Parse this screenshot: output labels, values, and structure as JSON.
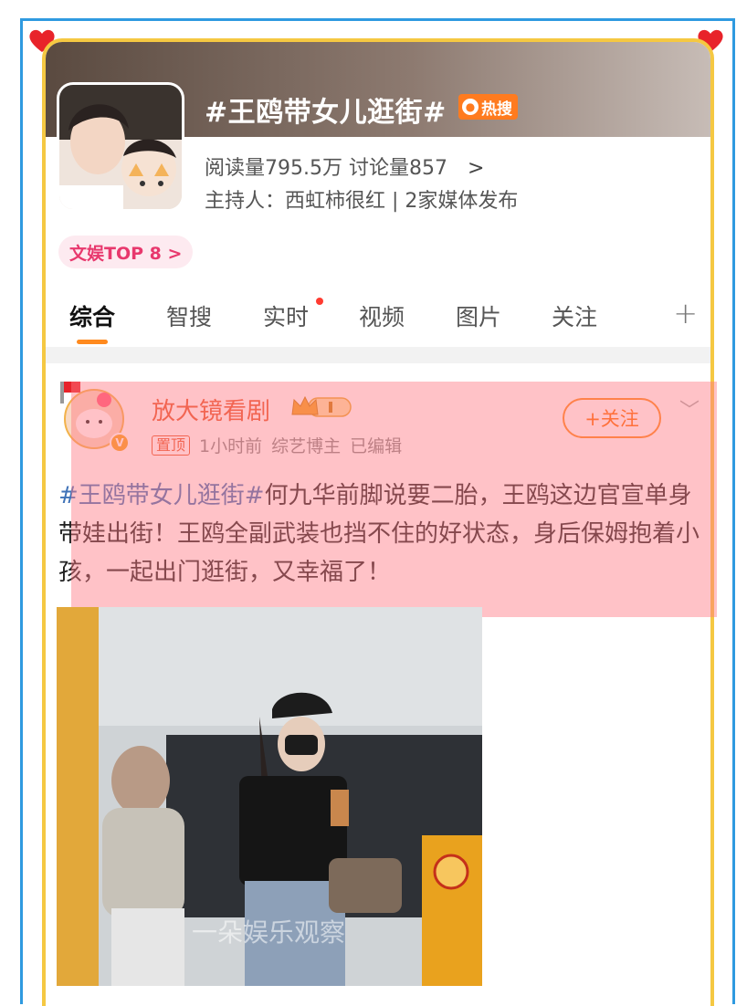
{
  "topic": {
    "title": "#王鸥带女儿逛街#",
    "hot_badge": "热搜",
    "stats": "阅读量795.5万 讨论量857",
    "arrow": ">",
    "host": "主持人：西虹柿很红 | 2家媒体发布",
    "rank": "文娱TOP 8 >"
  },
  "tabs": [
    {
      "label": "综合"
    },
    {
      "label": "智搜"
    },
    {
      "label": "实时"
    },
    {
      "label": "视频"
    },
    {
      "label": "图片"
    },
    {
      "label": "关注"
    }
  ],
  "tab_plus": "+",
  "post": {
    "author": "放大镜看剧",
    "pin_label": "置顶",
    "time": "1小时前",
    "role": "综艺博主",
    "edited": "已编辑",
    "follow_label": "+关注",
    "hashtag": "#王鸥带女儿逛街#",
    "body": "何九华前脚说要二胎，王鸥这边官宣单身 带娃出街！王鸥全副武装也挡不住的好状态，身后保姆抱着小孩，一起出门逛街，又幸福了！",
    "watermark": "一朵娱乐观察"
  },
  "colors": {
    "accent": "#ff8a1e",
    "outer_frame": "#2f9ae0",
    "inner_frame": "#f5c842",
    "highlight": "#ff7882",
    "hashtag": "#3f72b7"
  },
  "icons": [
    "heart-icon",
    "fire-icon",
    "chevron-right-icon",
    "plus-icon",
    "chevron-down-icon",
    "verified-icon",
    "crown-icon"
  ]
}
